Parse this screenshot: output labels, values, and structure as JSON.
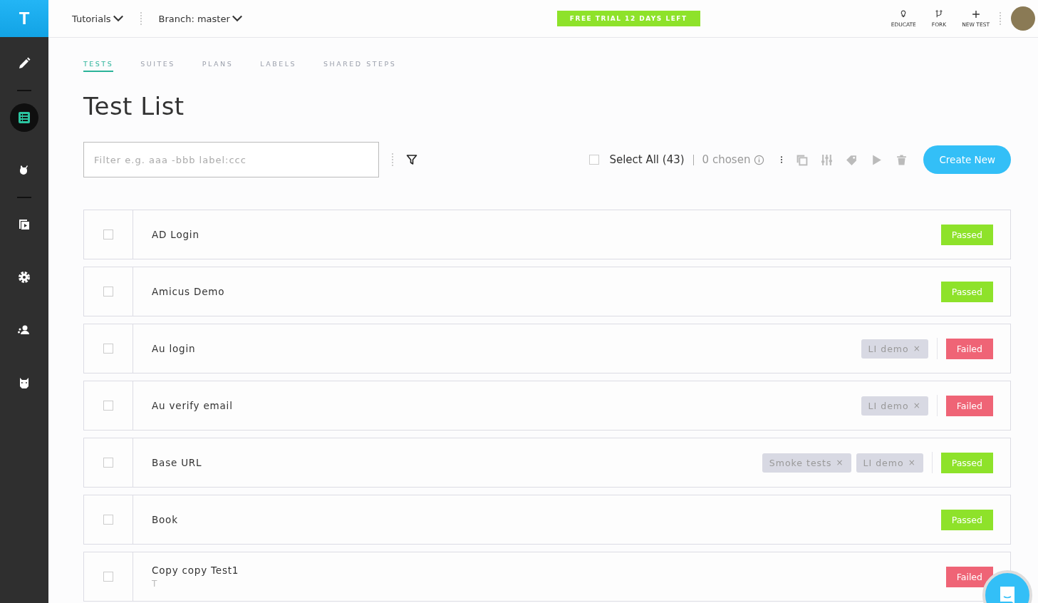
{
  "logo": "T",
  "sidebar": {
    "items": [
      {
        "selected": false
      },
      {
        "selected": true
      },
      {
        "selected": false
      },
      {
        "selected": false
      },
      {
        "selected": false
      },
      {
        "selected": false
      },
      {
        "selected": false
      }
    ]
  },
  "topbar": {
    "project": "Tutorials",
    "branch": "Branch: master",
    "trial": "FREE TRIAL 12 DAYS LEFT",
    "actions": [
      "EDUCATE",
      "FORK",
      "NEW TEST"
    ]
  },
  "tabs": [
    {
      "label": "TESTS",
      "selected": true
    },
    {
      "label": "SUITES",
      "selected": false
    },
    {
      "label": "PLANS",
      "selected": false
    },
    {
      "label": "LABELS",
      "selected": false
    },
    {
      "label": "SHARED STEPS",
      "selected": false
    }
  ],
  "title": "Test List",
  "filter": {
    "placeholder": "Filter e.g. aaa -bbb label:ccc"
  },
  "select_all": {
    "label": "Select All (43)",
    "checked": false
  },
  "chosen": "0 chosen",
  "create_button": "Create New",
  "tests": [
    {
      "name": "AD Login",
      "checked": false,
      "status": "Passed",
      "kind": "passed"
    },
    {
      "name": "Amicus Demo",
      "checked": false,
      "status": "Passed",
      "kind": "passed"
    },
    {
      "name": "Au login",
      "checked": false,
      "labels": [
        {
          "text": "LI demo",
          "remove": "×"
        }
      ],
      "status": "Failed",
      "kind": "failed"
    },
    {
      "name": "Au verify email",
      "checked": false,
      "labels": [
        {
          "text": "LI demo",
          "remove": "×"
        }
      ],
      "status": "Failed",
      "kind": "failed"
    },
    {
      "name": "Base URL",
      "checked": false,
      "labels": [
        {
          "text": "Smoke tests",
          "remove": "×"
        },
        {
          "text": "LI demo",
          "remove": "×"
        }
      ],
      "status": "Passed",
      "kind": "passed"
    },
    {
      "name": "Book",
      "checked": false,
      "status": "Passed",
      "kind": "passed"
    },
    {
      "name": "Copy copy Test1",
      "subtitle": "T",
      "checked": false,
      "status": "Failed",
      "kind": "failed"
    }
  ]
}
